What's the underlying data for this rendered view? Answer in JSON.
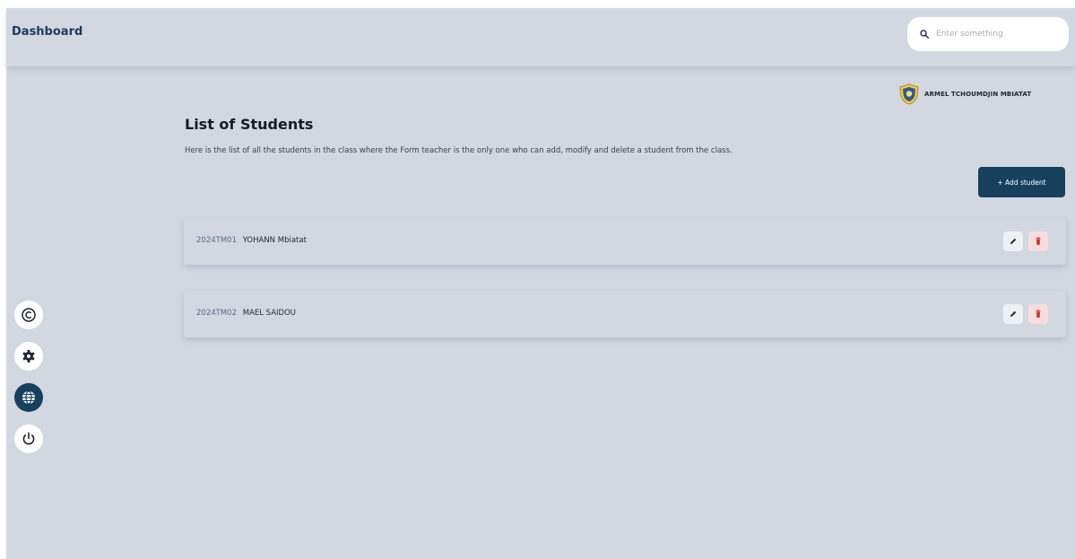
{
  "header": {
    "title": "Dashboard",
    "search_placeholder": "Enter something"
  },
  "user": {
    "name": "ARMEL TCHOUMDJIN MBIATAT"
  },
  "page": {
    "title": "List of Students",
    "description": "Here is the list of all the students in the class where the Form teacher is the only one who can add, modify and delete a student from the class.",
    "add_button_label": "+ Add student"
  },
  "students": [
    {
      "id": "2024TM01",
      "name": "YOHANN Mbiatat"
    },
    {
      "id": "2024TM02",
      "name": "MAEL SAIDOU"
    }
  ],
  "sidebar": {
    "icons": [
      "copyright-icon",
      "gear-icon",
      "globe-icon",
      "power-icon"
    ],
    "active_icon": "globe-icon"
  },
  "colors": {
    "background": "#d2d7e0",
    "primary": "#17405f",
    "title_blue": "#1b3a5c",
    "delete_bg": "#f6dede",
    "delete_icon": "#c0392b"
  }
}
